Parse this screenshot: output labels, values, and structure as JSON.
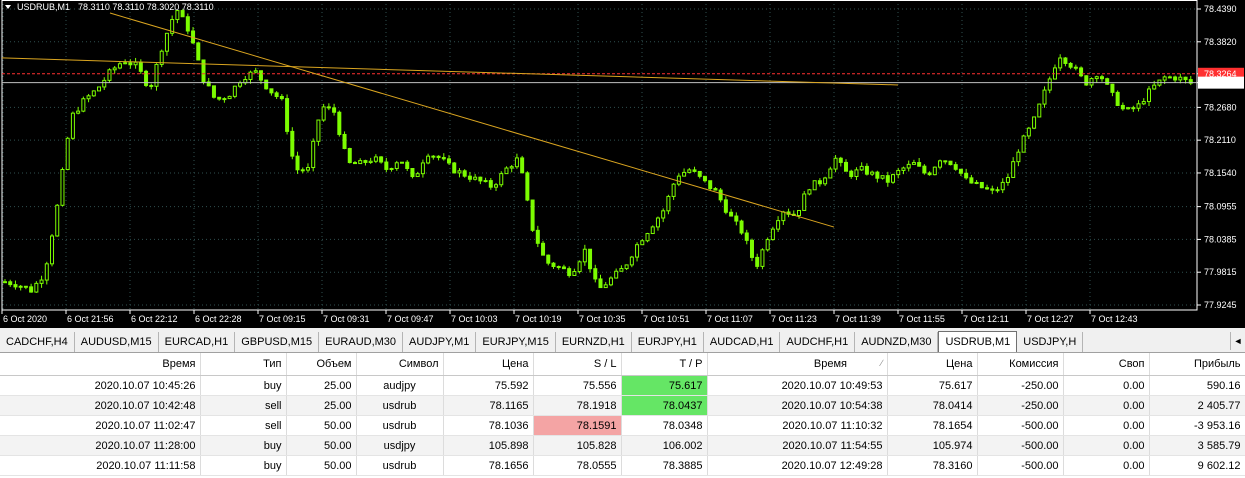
{
  "chart_data": {
    "type": "candlestick",
    "title": "USDRUB,M1",
    "ohlc": "78.3110 78.3110 78.3020 78.3110",
    "y_ticks": [
      "78.4390",
      "78.3820",
      "78.3264",
      "78.3110",
      "78.2680",
      "78.2110",
      "78.1540",
      "78.0955",
      "78.0385",
      "77.9815",
      "77.9245"
    ],
    "y_range": [
      77.9245,
      78.439
    ],
    "price_labels": {
      "red_line": 78.3264,
      "bid": 78.311
    },
    "x_ticks": [
      "6 Oct 2020",
      "6 Oct 21:56",
      "6 Oct 22:12",
      "6 Oct 22:28",
      "7 Oct 09:15",
      "7 Oct 09:31",
      "7 Oct 09:47",
      "7 Oct 10:03",
      "7 Oct 10:19",
      "7 Oct 10:35",
      "7 Oct 10:51",
      "7 Oct 11:07",
      "7 Oct 11:23",
      "7 Oct 11:39",
      "7 Oct 11:55",
      "7 Oct 12:11",
      "7 Oct 12:27",
      "7 Oct 12:43"
    ],
    "trendlines": [
      {
        "from": [
          "6 Oct 22:12",
          78.432
        ],
        "to": [
          "7 Oct 11:39",
          78.06
        ]
      },
      {
        "from": [
          "6 Oct 2020",
          78.354
        ],
        "to": [
          "7 Oct 11:55",
          78.307
        ]
      }
    ],
    "price_path": [
      77.965,
      77.96,
      77.95,
      77.98,
      78.1,
      78.25,
      78.28,
      78.3,
      78.33,
      78.35,
      78.34,
      78.3,
      78.38,
      78.44,
      78.4,
      78.32,
      78.28,
      78.29,
      78.32,
      78.33,
      78.3,
      78.28,
      78.16,
      78.16,
      78.27,
      78.26,
      78.17,
      78.17,
      78.18,
      78.16,
      78.18,
      78.14,
      78.19,
      78.18,
      78.16,
      78.15,
      78.14,
      78.13,
      78.16,
      78.18,
      78.06,
      78.0,
      77.99,
      77.98,
      78.02,
      77.95,
      77.97,
      77.99,
      78.03,
      78.06,
      78.09,
      78.15,
      78.16,
      78.14,
      78.12,
      78.08,
      78.05,
      77.99,
      78.05,
      78.09,
      78.08,
      78.13,
      78.14,
      78.18,
      78.15,
      78.16,
      78.15,
      78.14,
      78.16,
      78.17,
      78.15,
      78.18,
      78.17,
      78.14,
      78.13,
      78.12,
      78.14,
      78.2,
      78.24,
      78.3,
      78.36,
      78.34,
      78.31,
      78.33,
      78.29,
      78.26,
      78.27,
      78.3,
      78.32,
      78.32,
      78.31
    ]
  },
  "tabs": [
    "CADCHF,H4",
    "AUDUSD,M15",
    "EURCAD,H1",
    "GBPUSD,M15",
    "EURAUD,M30",
    "AUDJPY,M1",
    "EURJPY,M15",
    "EURNZD,H1",
    "EURJPY,H1",
    "AUDCAD,H1",
    "AUDCHF,H1",
    "AUDNZD,M30",
    "USDRUB,M1",
    "USDJPY,H"
  ],
  "active_tab": "USDRUB,M1",
  "tabs_scroll_glyph": "◄",
  "table": {
    "columns": [
      "Время",
      "Тип",
      "Объем",
      "Символ",
      "Цена",
      "S / L",
      "T / P",
      "Время",
      "Цена",
      "Комиссия",
      "Своп",
      "Прибыль"
    ],
    "sort_glyph": "∕",
    "rows": [
      [
        "2020.10.07 10:45:26",
        "buy",
        "25.00",
        "audjpy",
        "75.592",
        "75.556",
        "75.617",
        "2020.10.07 10:49:53",
        "75.617",
        "-250.00",
        "0.00",
        "590.16"
      ],
      [
        "2020.10.07 10:42:48",
        "sell",
        "25.00",
        "usdrub",
        "78.1165",
        "78.1918",
        "78.0437",
        "2020.10.07 10:54:38",
        "78.0414",
        "-250.00",
        "0.00",
        "2 405.77"
      ],
      [
        "2020.10.07 11:02:47",
        "sell",
        "50.00",
        "usdrub",
        "78.1036",
        "78.1591",
        "78.0348",
        "2020.10.07 11:10:32",
        "78.1654",
        "-500.00",
        "0.00",
        "-3 953.16"
      ],
      [
        "2020.10.07 11:28:00",
        "buy",
        "50.00",
        "usdjpy",
        "105.898",
        "105.828",
        "106.002",
        "2020.10.07 11:54:55",
        "105.974",
        "-500.00",
        "0.00",
        "3 585.79"
      ],
      [
        "2020.10.07 11:11:58",
        "buy",
        "50.00",
        "usdrub",
        "78.1656",
        "78.0555",
        "78.3885",
        "2020.10.07 12:49:28",
        "78.3160",
        "-500.00",
        "0.00",
        "9 602.12"
      ]
    ],
    "highlights": {
      "green": [
        [
          0,
          6
        ],
        [
          1,
          6
        ]
      ],
      "red": [
        [
          2,
          5
        ]
      ]
    },
    "colors": {
      "green": "#65e665",
      "red": "#f4a4a4"
    }
  },
  "colors": {
    "bg": "#000000",
    "candles": "#7cfc00",
    "grid": "#2f4f4f",
    "red_line": "#ff3030",
    "trend": "#daa520",
    "bid_line": "#c0c0c0"
  }
}
